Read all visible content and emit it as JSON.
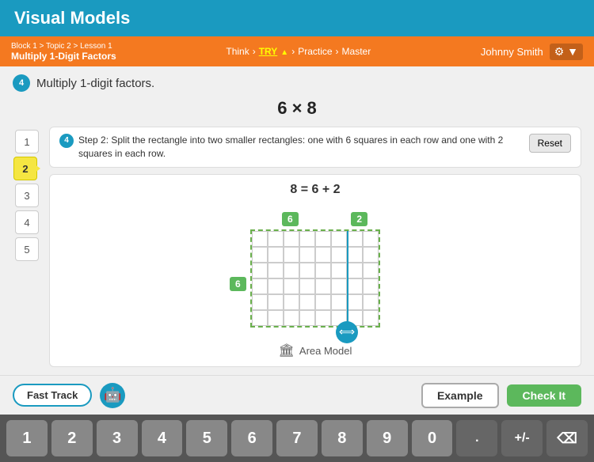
{
  "header": {
    "title": "Visual Models"
  },
  "navBar": {
    "breadcrumb": "Block 1 > Topic 2 > Lesson 1",
    "lessonName": "Multiply 1-Digit Factors",
    "steps": [
      "Think",
      "TRY",
      "Practice",
      "Master"
    ],
    "activeStep": "TRY",
    "user": "Johnny Smith"
  },
  "task": {
    "number": "4",
    "text": "Multiply 1-digit factors."
  },
  "equation": "6 × 8",
  "steps": [
    "1",
    "2",
    "3",
    "4",
    "5"
  ],
  "activeStep": "2",
  "instruction": {
    "stepNum": "4",
    "text": "Step 2: Split the rectangle into two smaller rectangles: one with 6 squares in each row and one with 2 squares in each row.",
    "resetLabel": "Reset"
  },
  "splitEquation": "8 = 6 + 2",
  "badges": {
    "top6": "6",
    "top2": "2",
    "left6": "6"
  },
  "areaModel": {
    "icon": "🏛",
    "label": "Area Model"
  },
  "bottomBar": {
    "fastTrackLabel": "Fast Track",
    "exampleLabel": "Example",
    "checkLabel": "Check It"
  },
  "numpad": {
    "keys": [
      "1",
      "2",
      "3",
      "4",
      "5",
      "6",
      "7",
      "8",
      "9",
      "0"
    ],
    "decimalLabel": ".",
    "plusMinusLabel": "+/-",
    "backspaceLabel": "⌫"
  }
}
